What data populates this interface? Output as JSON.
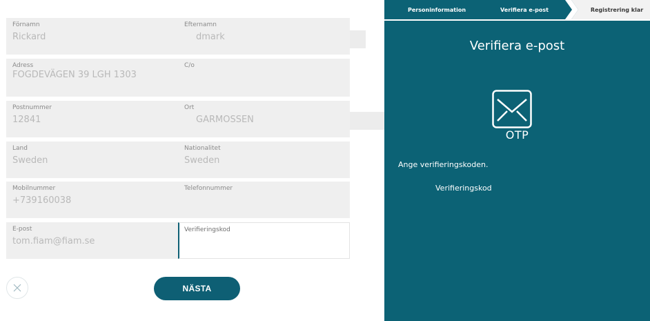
{
  "form": {
    "firstname": {
      "label": "Förnamn",
      "value": "Rickard"
    },
    "lastname": {
      "label": "Efternamn",
      "value": "dmark"
    },
    "address": {
      "label": "Adress",
      "value": "FOGDEVÄGEN 39 LGH 1303"
    },
    "co": {
      "label": "C/o",
      "value": ""
    },
    "postal_code": {
      "label": "Postnummer",
      "value": "12841"
    },
    "city": {
      "label": "Ort",
      "value": "GARMOSSEN"
    },
    "country": {
      "label": "Land",
      "value": "Sweden"
    },
    "nationality": {
      "label": "Nationalitet",
      "value": "Sweden"
    },
    "mobile": {
      "label": "Mobilnummer",
      "value": "+739160038"
    },
    "phone": {
      "label": "Telefonnummer",
      "value": ""
    },
    "email": {
      "label": "E-post",
      "value": "tom.fiam@fiam.se"
    },
    "verification_code": {
      "label": "Verifieringskod",
      "value": ""
    }
  },
  "actions": {
    "next_label": "NÄSTA",
    "close_icon": "close-icon"
  },
  "steps": [
    {
      "label": "Personinformation",
      "state": "done"
    },
    {
      "label": "Verifiera e-post",
      "state": "active"
    },
    {
      "label": "Registrering klar",
      "state": "upcoming"
    }
  ],
  "panel": {
    "title": "Verifiera e-post",
    "icon": "envelope-icon",
    "otp_label": "OTP",
    "instruction": "Ange verifieringskoden.",
    "code_label": "Verifieringskod"
  },
  "colors": {
    "accent": "#0e5f74",
    "panel_bg": "#0c6275",
    "field_bg": "#efefef",
    "step_upcoming_bg": "#f2f2f2"
  }
}
